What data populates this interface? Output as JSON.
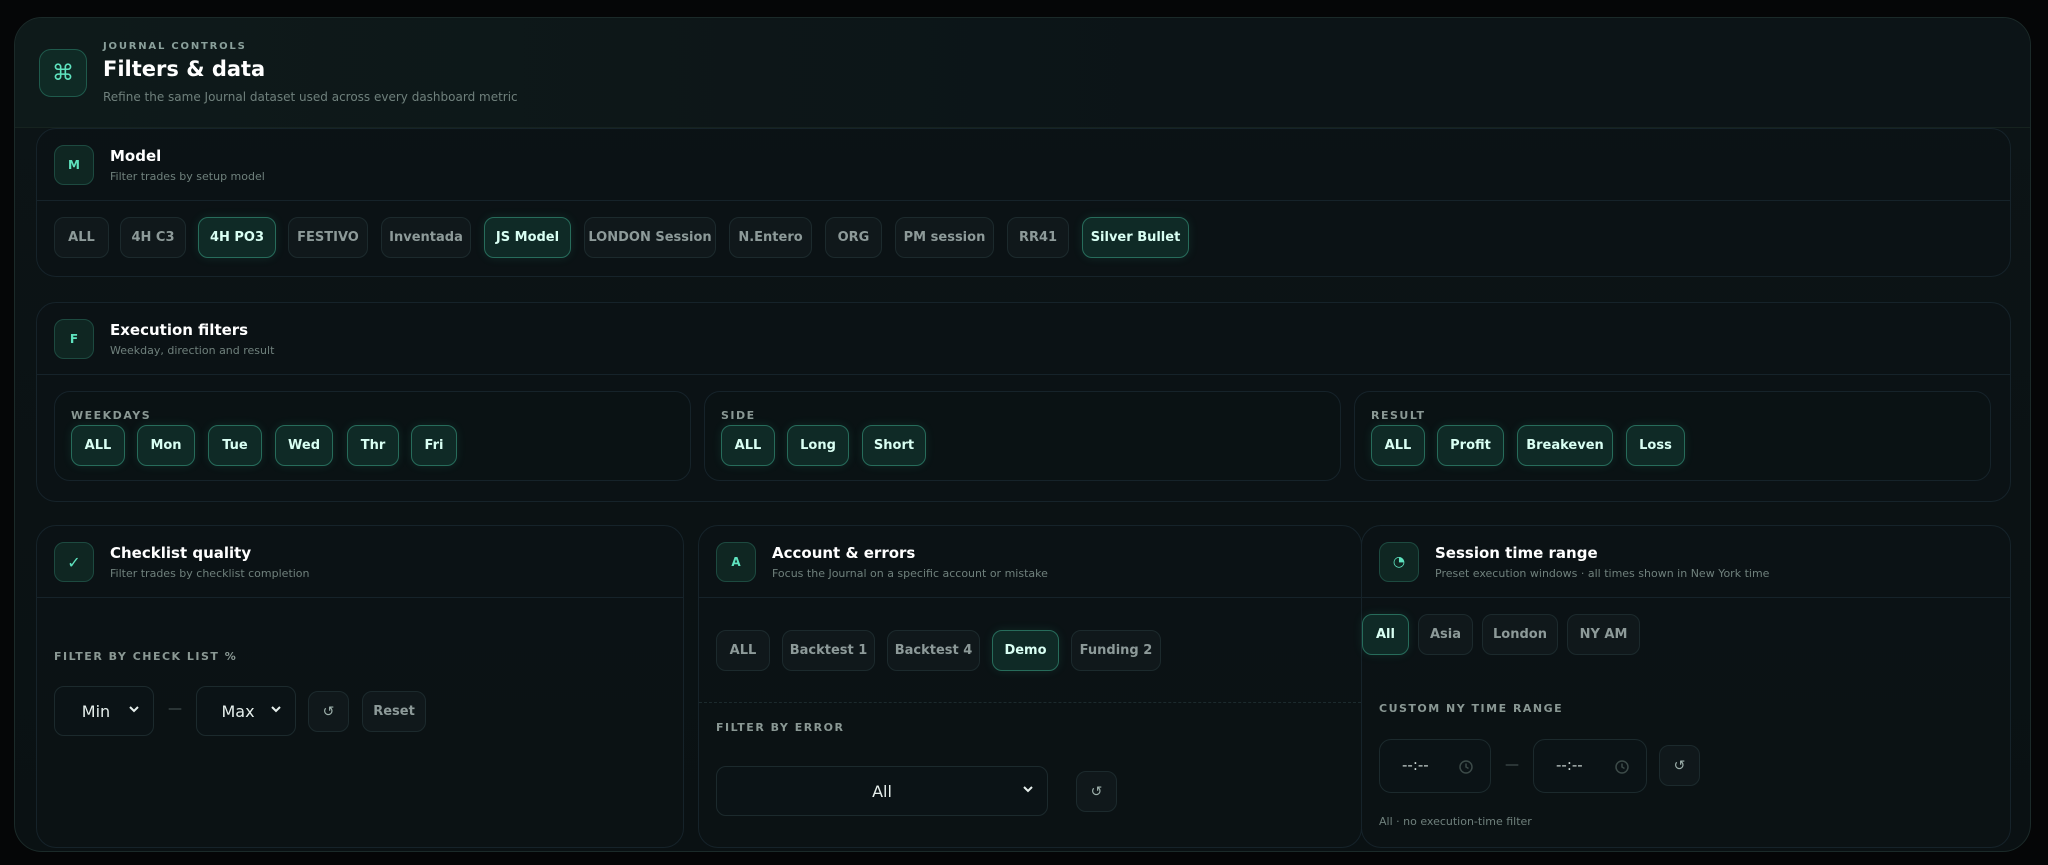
{
  "header": {
    "icon": "command-icon",
    "eyebrow": "JOURNAL CONTROLS",
    "title": "Filters & data",
    "subtitle": "Refine the same Journal dataset used across every dashboard metric"
  },
  "model": {
    "badge": "M",
    "title": "Model",
    "subtitle": "Filter trades by setup model",
    "chips": [
      "ALL",
      "4H C3",
      "4H PO3",
      "FESTIVO",
      "Inventada",
      "JS Model",
      "LONDON Session",
      "N.Entero",
      "ORG",
      "PM session",
      "RR41",
      "Silver Bullet"
    ],
    "active": [
      "4H PO3",
      "JS Model",
      "Silver Bullet"
    ]
  },
  "execution": {
    "badge": "F",
    "title": "Execution filters",
    "subtitle": "Weekday, direction and result",
    "weekdays": {
      "label": "WEEKDAYS",
      "chips": [
        "ALL",
        "Mon",
        "Tue",
        "Wed",
        "Thr",
        "Fri"
      ]
    },
    "side": {
      "label": "SIDE",
      "chips": [
        "ALL",
        "Long",
        "Short"
      ]
    },
    "result": {
      "label": "RESULT",
      "chips": [
        "ALL",
        "Profit",
        "Breakeven",
        "Loss"
      ]
    }
  },
  "checklist": {
    "badge": "✓",
    "title": "Checklist quality",
    "subtitle": "Filter trades by checklist completion",
    "filter_label": "FILTER BY CHECK LIST %",
    "min": "Min",
    "max": "Max",
    "dash": "—",
    "reset_icon": "↺",
    "reset": "Reset"
  },
  "account": {
    "badge": "A",
    "title": "Account & errors",
    "subtitle": "Focus the Journal on a specific account or mistake",
    "chips": [
      "ALL",
      "Backtest 1",
      "Backtest 4",
      "Demo",
      "Funding 2"
    ],
    "active": "Demo",
    "error_label": "FILTER BY ERROR",
    "error_value": "All",
    "reset_icon": "↺"
  },
  "session": {
    "badge": "◔",
    "title": "Session time range",
    "subtitle": "Preset execution windows · all times shown in New York time",
    "chips": [
      "All",
      "Asia",
      "London",
      "NY AM"
    ],
    "active": "All",
    "custom_label": "CUSTOM NY TIME RANGE",
    "from": "--:--",
    "to": "--:--",
    "dash": "—",
    "reset_icon": "↺",
    "note": "All · no execution-time filter"
  },
  "colors": {
    "accent": "#5fe3bf",
    "background": "#0a1113",
    "chip_active_bg": "#0f2a26"
  }
}
